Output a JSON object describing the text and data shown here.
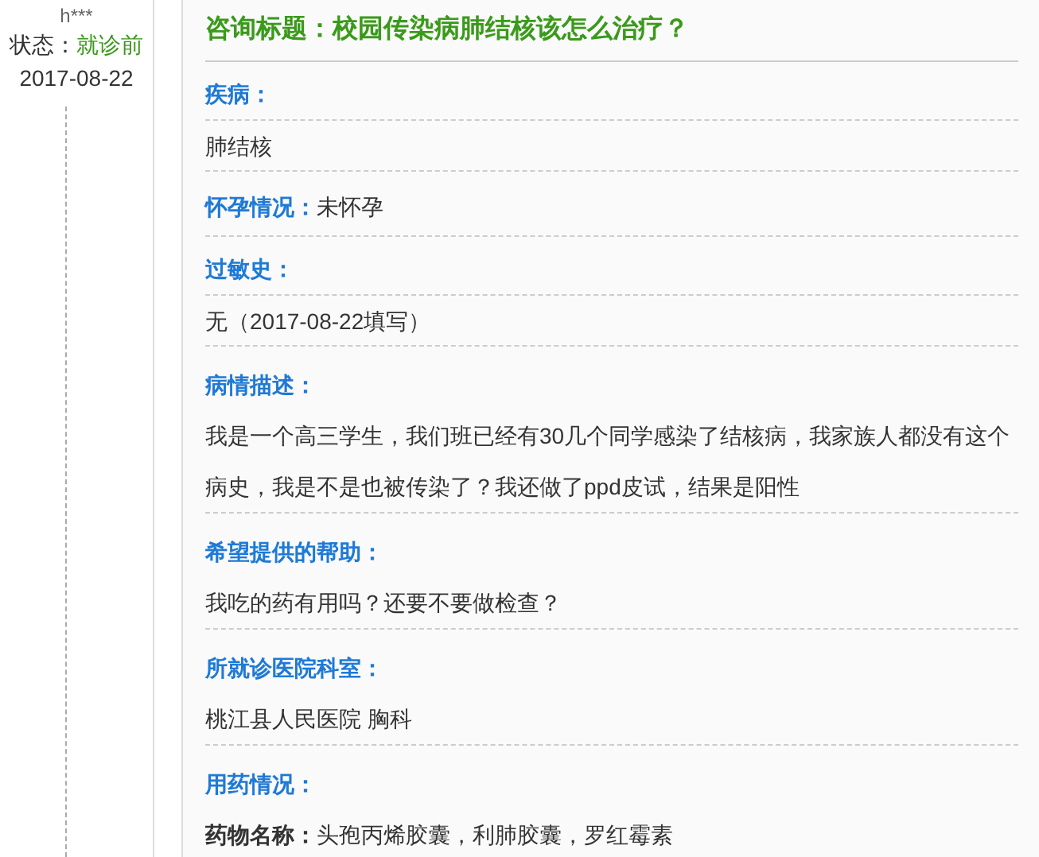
{
  "user": {
    "name": "h***",
    "status_label": "状态：",
    "status": "就诊前",
    "date": "2017-08-22"
  },
  "title": "咨询标题：校园传染病肺结核该怎么治疗？",
  "fields": [
    {
      "kind": "field",
      "label": "疾病：",
      "value": "肺结核"
    },
    {
      "kind": "inline",
      "label": "怀孕情况：",
      "value": "未怀孕"
    },
    {
      "kind": "field",
      "label": "过敏史：",
      "value": "无（2017-08-22填写）"
    },
    {
      "kind": "section",
      "label": "病情描述：",
      "value": "我是一个高三学生，我们班已经有30几个同学感染了结核病，我家族人都没有这个病史，我是不是也被传染了？我还做了ppd皮试，结果是阳性"
    },
    {
      "kind": "section",
      "label": "希望提供的帮助：",
      "value": "我吃的药有用吗？还要不要做检查？"
    },
    {
      "kind": "section",
      "label": "所就诊医院科室：",
      "value": "桃江县人民医院 胸科"
    },
    {
      "kind": "open",
      "label": "用药情况：",
      "value": "**药物名称：**头孢丙烯胶囊，利肺胶囊，罗红霉素"
    }
  ]
}
